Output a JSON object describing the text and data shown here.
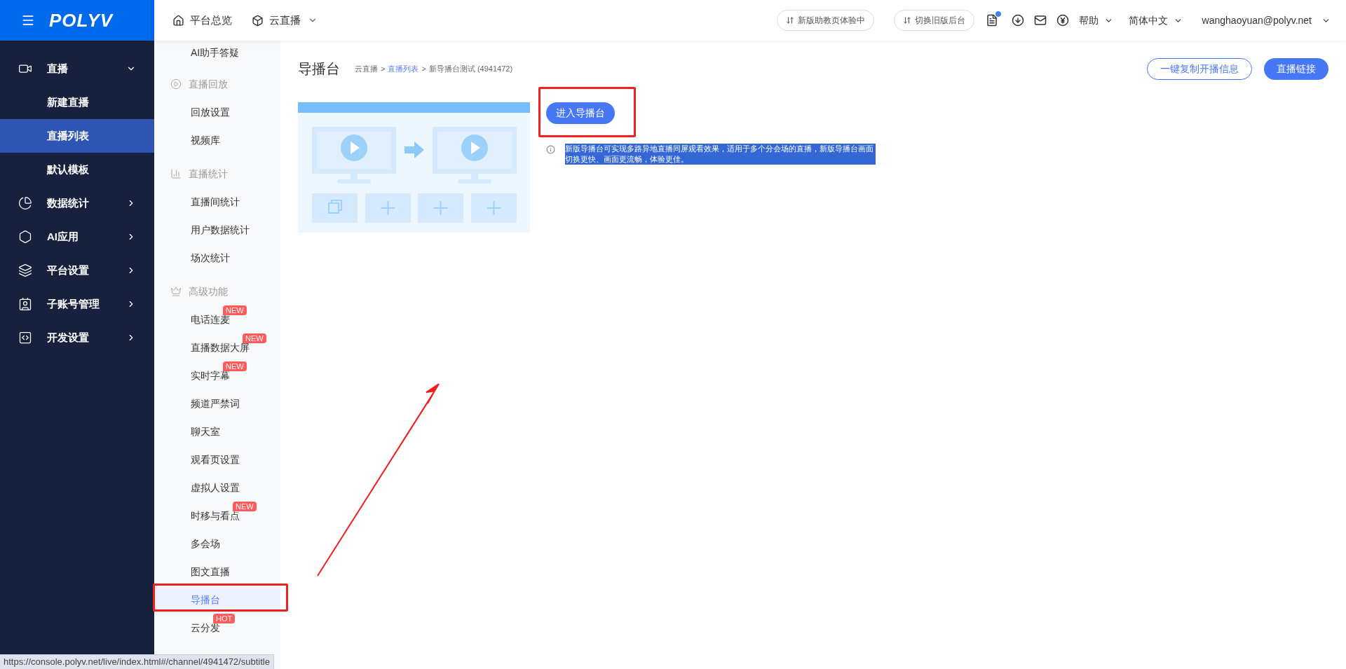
{
  "top_bar": {
    "logo": "POLYV",
    "nav": [
      {
        "kind": "home",
        "label": "平台总览"
      },
      {
        "kind": "dropdown",
        "label": "云直播"
      }
    ],
    "pill_buttons": [
      "新版助教页体验中",
      "切换旧版后台"
    ],
    "help": "帮助",
    "language": "简体中文",
    "account": "wanghaoyuan@polyv.net"
  },
  "sidebar": {
    "items": [
      {
        "label": "直播",
        "expanded": true,
        "children": [
          {
            "label": "新建直播",
            "selected": false
          },
          {
            "label": "直播列表",
            "selected": true
          },
          {
            "label": "默认模板",
            "selected": false
          }
        ]
      },
      {
        "label": "数据统计",
        "expanded": false
      },
      {
        "label": "AI应用",
        "expanded": false
      },
      {
        "label": "平台设置",
        "expanded": false
      },
      {
        "label": "子账号管理",
        "expanded": false
      },
      {
        "label": "开发设置",
        "expanded": false
      }
    ]
  },
  "submenu": {
    "items": [
      {
        "kind": "item",
        "label": "AI助手答疑",
        "selected": false
      },
      {
        "kind": "header",
        "label": "直播回放"
      },
      {
        "kind": "item",
        "label": "回放设置",
        "selected": false
      },
      {
        "kind": "item",
        "label": "视频库",
        "selected": false
      },
      {
        "kind": "header",
        "label": "直播统计"
      },
      {
        "kind": "item",
        "label": "直播间统计",
        "selected": false
      },
      {
        "kind": "item",
        "label": "用户数据统计",
        "selected": false
      },
      {
        "kind": "item",
        "label": "场次统计",
        "selected": false
      },
      {
        "kind": "header",
        "label": "高级功能"
      },
      {
        "kind": "item",
        "label": "电话连麦",
        "badge": "NEW",
        "selected": false
      },
      {
        "kind": "item",
        "label": "直播数据大屏",
        "badge": "NEW",
        "selected": false
      },
      {
        "kind": "item",
        "label": "实时字幕",
        "badge": "NEW",
        "selected": false
      },
      {
        "kind": "item",
        "label": "频道严禁词",
        "selected": false
      },
      {
        "kind": "item",
        "label": "聊天室",
        "selected": false
      },
      {
        "kind": "item",
        "label": "观看页设置",
        "selected": false
      },
      {
        "kind": "item",
        "label": "虚拟人设置",
        "selected": false
      },
      {
        "kind": "item",
        "label": "时移与看点",
        "badge": "NEW",
        "selected": false
      },
      {
        "kind": "item",
        "label": "多会场",
        "selected": false
      },
      {
        "kind": "item",
        "label": "图文直播",
        "selected": false
      },
      {
        "kind": "item",
        "label": "导播台",
        "selected": true
      },
      {
        "kind": "item",
        "label": "云分发",
        "badge": "HOT",
        "selected": false
      }
    ]
  },
  "page": {
    "title": "导播台",
    "breadcrumb_separator": ">",
    "breadcrumb": [
      {
        "label": "云直播",
        "link": false
      },
      {
        "label": "直播列表",
        "link": true
      },
      {
        "label": "新导播台测试 (4941472)",
        "link": false
      }
    ],
    "actions": [
      {
        "label": "一键复制开播信息",
        "primary": false
      },
      {
        "label": "直播链接",
        "primary": true
      }
    ],
    "enter_button": "进入导播台",
    "info": {
      "text": "新版导播台可实现多路异地直播同屏观看效果，适用于多个分会场的直播，新版导播台画面切换更快、画面更流畅，体验更佳。",
      "highlighted": true
    }
  },
  "status_url": "https://console.polyv.net/live/index.html#/channel/4941472/subtitle"
}
